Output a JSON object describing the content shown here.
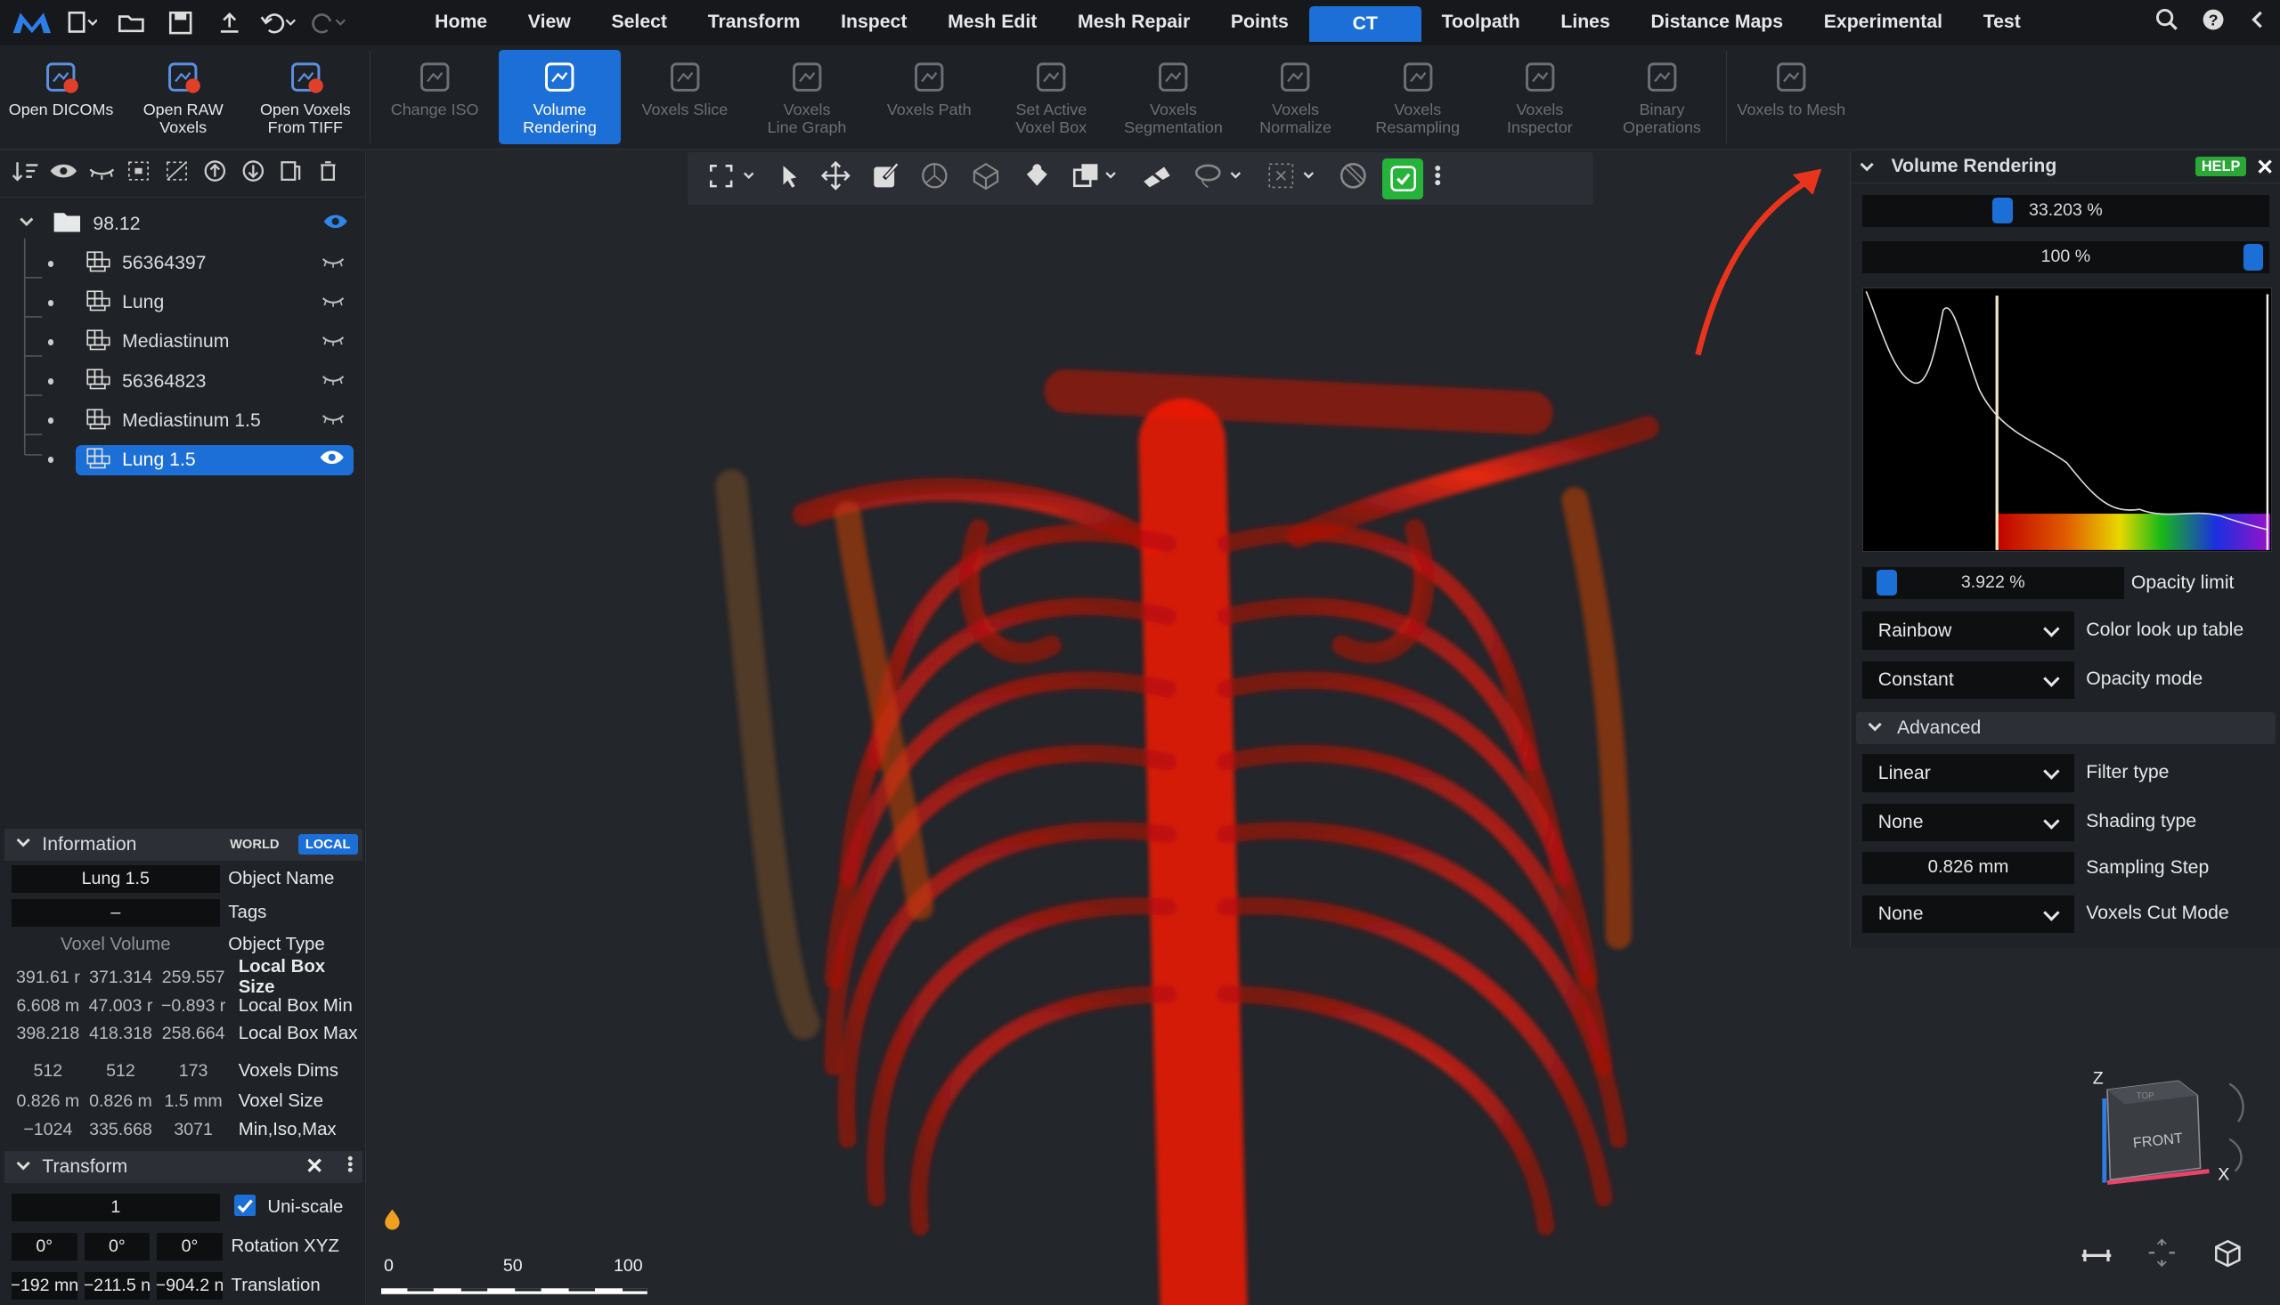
{
  "menu": {
    "tabs": [
      "Home",
      "View",
      "Select",
      "Transform",
      "Inspect",
      "Mesh Edit",
      "Mesh Repair",
      "Points",
      "CT",
      "Toolpath",
      "Lines",
      "Distance Maps",
      "Experimental",
      "Test"
    ],
    "active": "CT"
  },
  "ribbon": [
    {
      "l1": "Open DICOMs",
      "l2": "",
      "state": "normal"
    },
    {
      "l1": "Open RAW",
      "l2": "Voxels",
      "state": "normal"
    },
    {
      "l1": "Open Voxels",
      "l2": "From TIFF",
      "state": "normal"
    },
    {
      "l1": "Change ISO",
      "l2": "",
      "state": "disabled"
    },
    {
      "l1": "Volume",
      "l2": "Rendering",
      "state": "active"
    },
    {
      "l1": "Voxels Slice",
      "l2": "",
      "state": "disabled"
    },
    {
      "l1": "Voxels",
      "l2": "Line Graph",
      "state": "disabled"
    },
    {
      "l1": "Voxels Path",
      "l2": "",
      "state": "disabled"
    },
    {
      "l1": "Set Active",
      "l2": "Voxel Box",
      "state": "disabled"
    },
    {
      "l1": "Voxels",
      "l2": "Segmentation",
      "state": "disabled"
    },
    {
      "l1": "Voxels",
      "l2": "Normalize",
      "state": "disabled"
    },
    {
      "l1": "Voxels",
      "l2": "Resampling",
      "state": "disabled"
    },
    {
      "l1": "Voxels",
      "l2": "Inspector",
      "state": "disabled"
    },
    {
      "l1": "Binary",
      "l2": "Operations",
      "state": "disabled"
    },
    {
      "l1": "Voxels to Mesh",
      "l2": "",
      "state": "disabled"
    }
  ],
  "tree": {
    "root": "98.12",
    "items": [
      "56364397",
      "Lung",
      "Mediastinum",
      "56364823",
      "Mediastinum 1.5",
      "Lung 1.5"
    ],
    "selected": "Lung 1.5"
  },
  "info": {
    "title": "Information",
    "world": "WORLD",
    "local": "LOCAL",
    "object_name": "Lung 1.5",
    "object_name_label": "Object Name",
    "tags": "–",
    "tags_label": "Tags",
    "object_type": "Voxel Volume",
    "object_type_label": "Object Type",
    "rows": [
      {
        "v": [
          "391.61 r",
          "371.314",
          "259.557"
        ],
        "k": "Local Box Size",
        "bold": true
      },
      {
        "v": [
          "6.608 m",
          "47.003 r",
          "−0.893 r"
        ],
        "k": "Local Box Min",
        "bold": false
      },
      {
        "v": [
          "398.218",
          "418.318",
          "258.664"
        ],
        "k": "Local Box Max",
        "bold": false
      },
      {
        "v": [
          "512",
          "512",
          "173"
        ],
        "k": "Voxels Dims",
        "bold": false
      },
      {
        "v": [
          "0.826 m",
          "0.826 m",
          "1.5 mm"
        ],
        "k": "Voxel Size",
        "bold": false
      },
      {
        "v": [
          "−1024",
          "335.668",
          "3071"
        ],
        "k": "Min,Iso,Max",
        "bold": false
      }
    ]
  },
  "transform": {
    "title": "Transform",
    "scale": "1",
    "uniscale": "Uni-scale",
    "rot": [
      "0°",
      "0°",
      "0°"
    ],
    "rot_label": "Rotation XYZ",
    "trans": [
      "−192 mn",
      "−211.5 n",
      "−904.2 n"
    ],
    "trans_label": "Translation"
  },
  "scale_bar": {
    "t0": "0",
    "t1": "50",
    "t2": "100"
  },
  "vr": {
    "title": "Volume Rendering",
    "help": "HELP",
    "s1": "33.203 %",
    "s1_pos": 0.33203,
    "s2": "100 %",
    "s2_pos": 1.0,
    "opacity": "3.922 %",
    "opacity_pos": 0.03922,
    "opacity_label": "Opacity limit",
    "clut": "Rainbow",
    "clut_label": "Color look up table",
    "opmode": "Constant",
    "opmode_label": "Opacity mode",
    "advanced": "Advanced",
    "filter": "Linear",
    "filter_label": "Filter type",
    "shading": "None",
    "shading_label": "Shading type",
    "step": "0.826 mm",
    "step_label": "Sampling Step",
    "cut": "None",
    "cut_label": "Voxels Cut Mode"
  },
  "cube": {
    "face": "FRONT",
    "top": "TOP",
    "z": "Z",
    "x": "X"
  },
  "colors": {
    "accent": "#1c6fd6",
    "bone": "#e01010",
    "help": "#2aa835"
  }
}
